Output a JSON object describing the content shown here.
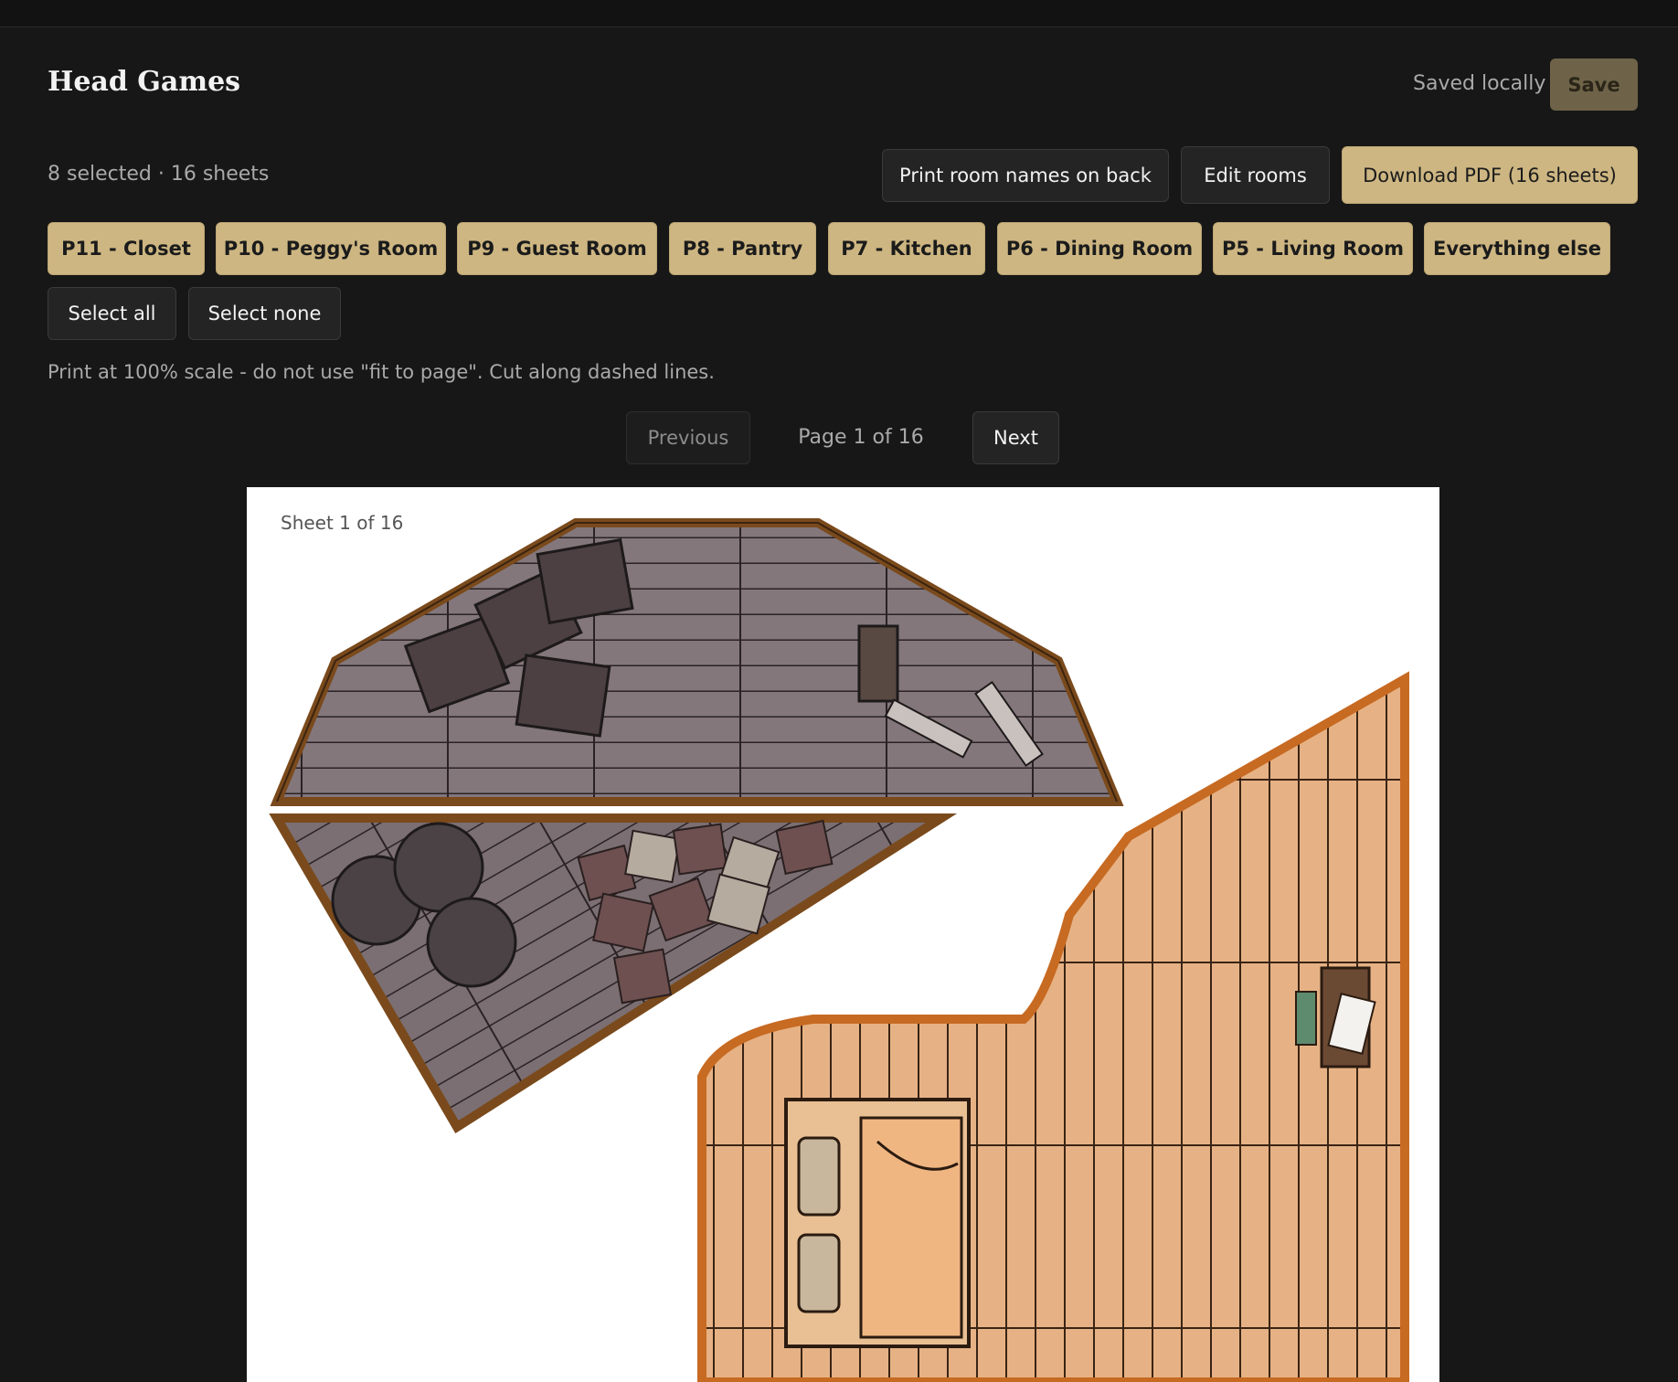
{
  "header": {
    "title": "Head Games",
    "saved_status": "Saved locally",
    "save_label": "Save"
  },
  "toolbar": {
    "summary": "8 selected · 16 sheets",
    "print_names_label": "Print room names on back",
    "edit_rooms_label": "Edit rooms",
    "download_label": "Download PDF (16 sheets)"
  },
  "rooms": [
    {
      "label": "P11 - Closet",
      "selected": true
    },
    {
      "label": "P10 - Peggy's Room",
      "selected": true
    },
    {
      "label": "P9 - Guest Room",
      "selected": true
    },
    {
      "label": "P8 - Pantry",
      "selected": true
    },
    {
      "label": "P7 - Kitchen",
      "selected": true
    },
    {
      "label": "P6 - Dining Room",
      "selected": true
    },
    {
      "label": "P5 - Living Room",
      "selected": true
    },
    {
      "label": "Everything else",
      "selected": true
    }
  ],
  "selection": {
    "select_all_label": "Select all",
    "select_none_label": "Select none"
  },
  "hint": "Print at 100% scale - do not use \"fit to page\". Cut along dashed lines.",
  "pagination": {
    "previous_label": "Previous",
    "next_label": "Next",
    "page_indicator": "Page 1 of 16"
  },
  "sheet": {
    "label": "Sheet 1 of 16"
  },
  "colors": {
    "accent_gold": "#cdb682",
    "background": "#171717"
  }
}
